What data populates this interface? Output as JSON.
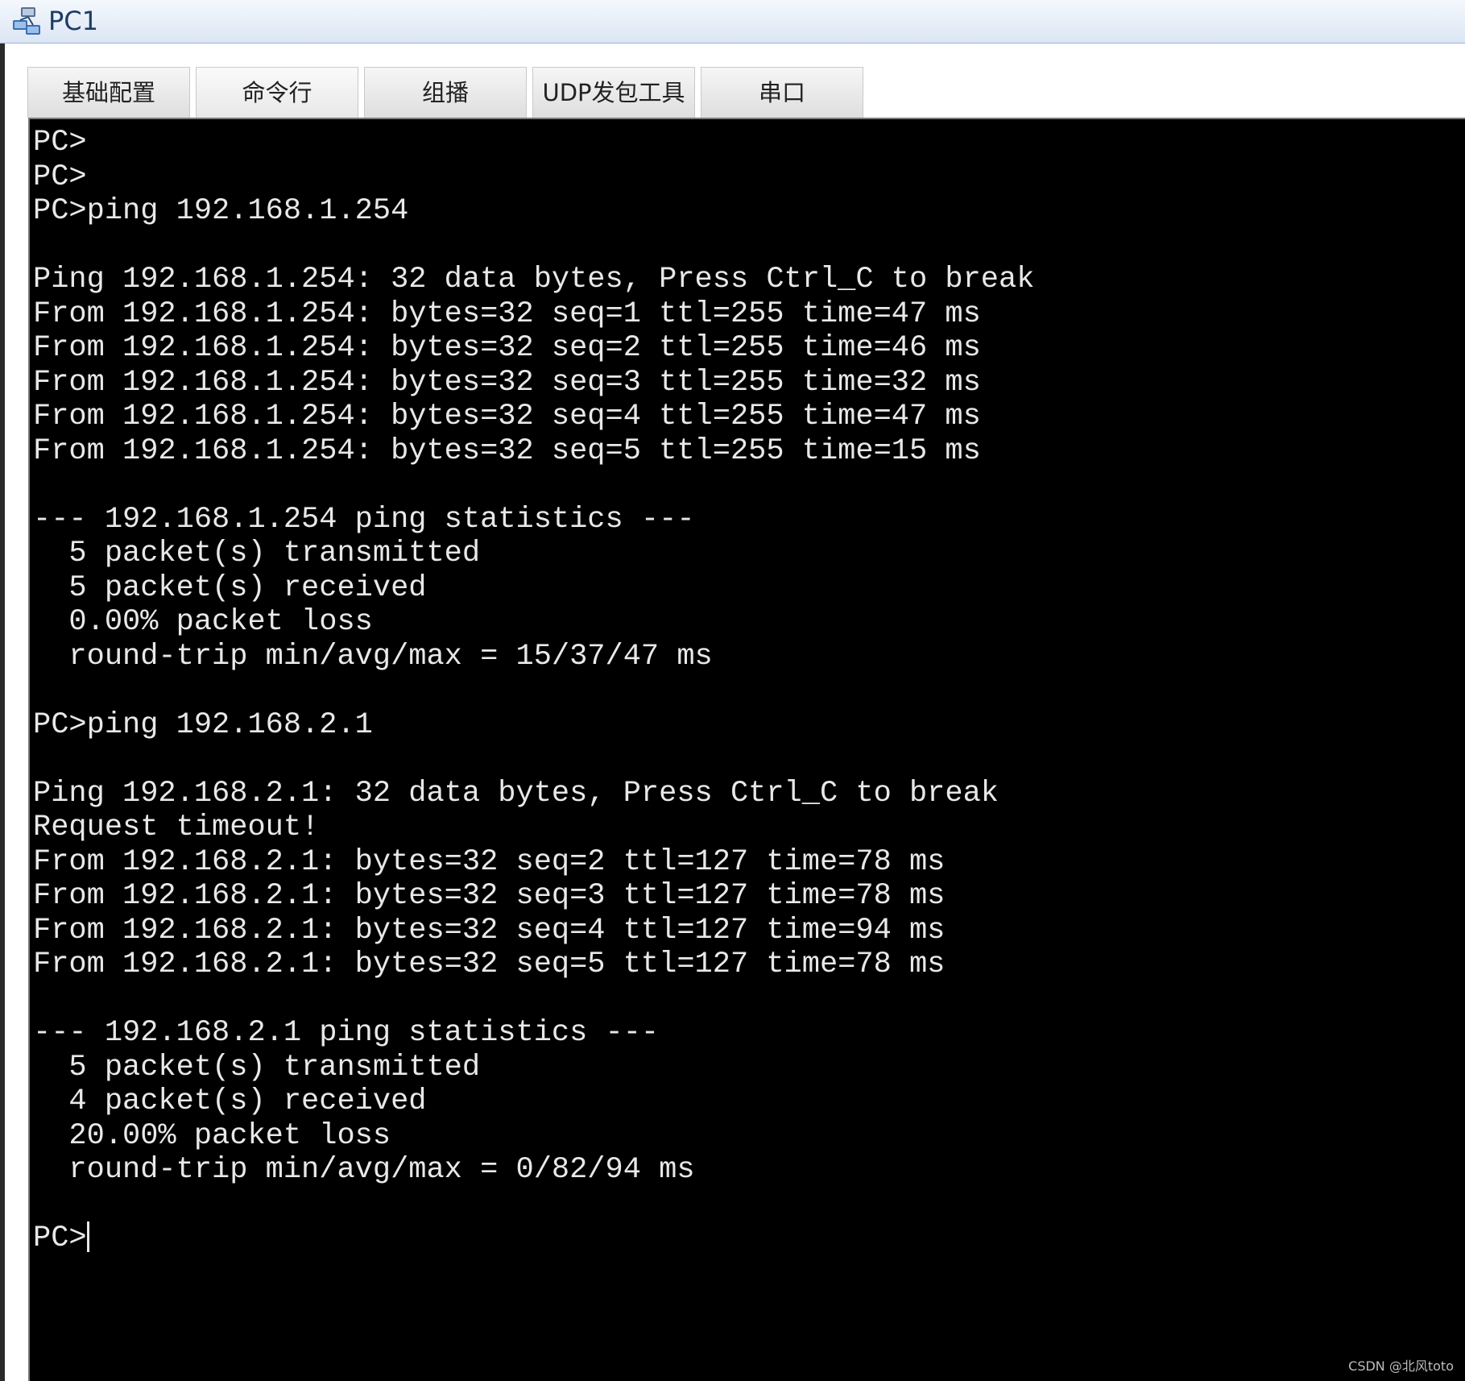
{
  "window": {
    "title": "PC1",
    "icon": "pc-network-icon"
  },
  "tabs": [
    {
      "label": "基础配置",
      "active": false
    },
    {
      "label": "命令行",
      "active": true
    },
    {
      "label": "组播",
      "active": false
    },
    {
      "label": "UDP发包工具",
      "active": false
    },
    {
      "label": "串口",
      "active": false
    }
  ],
  "terminal": {
    "lines": [
      "PC>",
      "PC>",
      "PC>ping 192.168.1.254",
      "",
      "Ping 192.168.1.254: 32 data bytes, Press Ctrl_C to break",
      "From 192.168.1.254: bytes=32 seq=1 ttl=255 time=47 ms",
      "From 192.168.1.254: bytes=32 seq=2 ttl=255 time=46 ms",
      "From 192.168.1.254: bytes=32 seq=3 ttl=255 time=32 ms",
      "From 192.168.1.254: bytes=32 seq=4 ttl=255 time=47 ms",
      "From 192.168.1.254: bytes=32 seq=5 ttl=255 time=15 ms",
      "",
      "--- 192.168.1.254 ping statistics ---",
      "  5 packet(s) transmitted",
      "  5 packet(s) received",
      "  0.00% packet loss",
      "  round-trip min/avg/max = 15/37/47 ms",
      "",
      "PC>ping 192.168.2.1",
      "",
      "Ping 192.168.2.1: 32 data bytes, Press Ctrl_C to break",
      "Request timeout!",
      "From 192.168.2.1: bytes=32 seq=2 ttl=127 time=78 ms",
      "From 192.168.2.1: bytes=32 seq=3 ttl=127 time=78 ms",
      "From 192.168.2.1: bytes=32 seq=4 ttl=127 time=94 ms",
      "From 192.168.2.1: bytes=32 seq=5 ttl=127 time=78 ms",
      "",
      "--- 192.168.2.1 ping statistics ---",
      "  5 packet(s) transmitted",
      "  4 packet(s) received",
      "  20.00% packet loss",
      "  round-trip min/avg/max = 0/82/94 ms",
      ""
    ],
    "prompt": "PC>"
  },
  "watermark": "CSDN @北风toto",
  "colors": {
    "terminal_bg": "#000000",
    "terminal_fg": "#e8e8e8",
    "title_fg": "#1f3c66"
  }
}
